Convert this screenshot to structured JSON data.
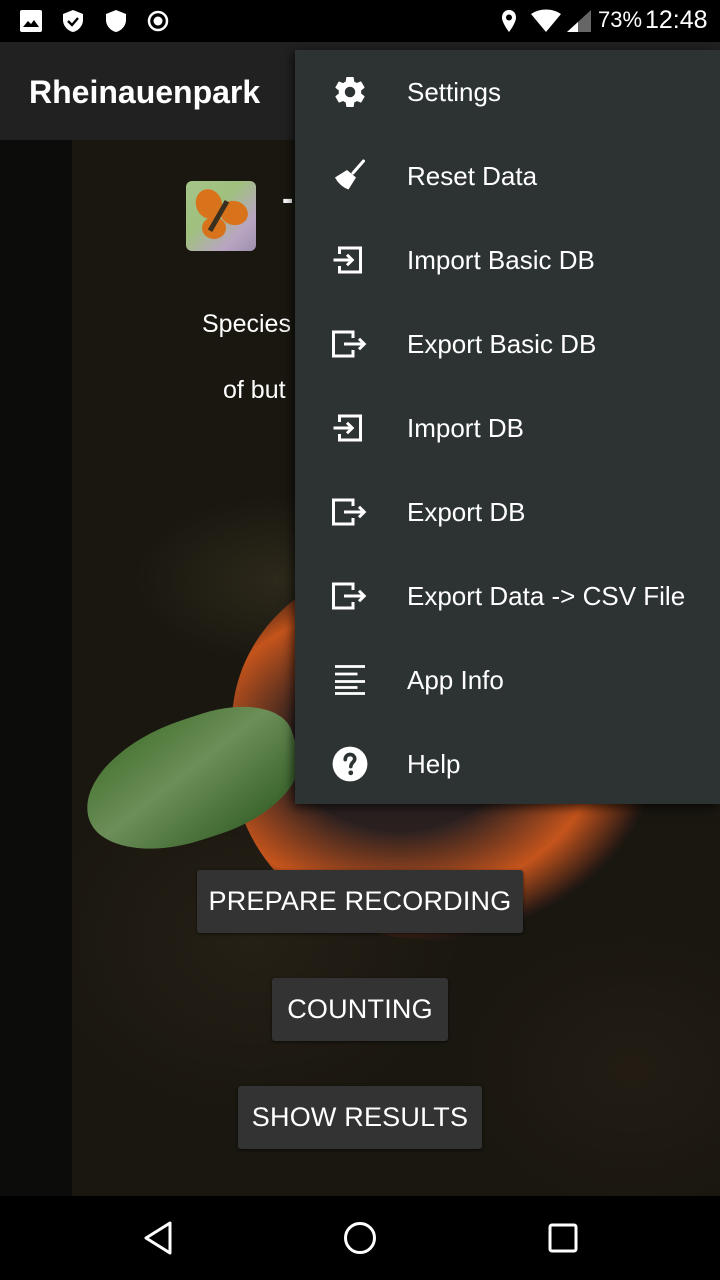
{
  "status_bar": {
    "left_icons": [
      "image-icon",
      "shield-check-icon",
      "shield-icon",
      "record-icon"
    ],
    "right_icons": [
      "location-icon",
      "wifi-icon",
      "cell-signal-icon"
    ],
    "battery": "73%",
    "time": "12:48"
  },
  "app_bar": {
    "title": "Rheinauenpark"
  },
  "main": {
    "heading_partial": "-",
    "subtext_line1_partial": "Species",
    "subtext_line2_partial": "of but",
    "buttons": {
      "prepare_recording": "PREPARE RECORDING",
      "counting": "COUNTING",
      "show_results": "SHOW RESULTS"
    }
  },
  "overflow_menu": {
    "items": [
      {
        "label": "Settings",
        "icon": "gear-icon"
      },
      {
        "label": "Reset Data",
        "icon": "broom-icon"
      },
      {
        "label": "Import Basic DB",
        "icon": "import-icon"
      },
      {
        "label": "Export Basic DB",
        "icon": "export-icon"
      },
      {
        "label": "Import DB",
        "icon": "import-icon"
      },
      {
        "label": "Export DB",
        "icon": "export-icon"
      },
      {
        "label": "Export Data -> CSV File",
        "icon": "export-icon"
      },
      {
        "label": "App Info",
        "icon": "text-lines-icon"
      },
      {
        "label": "Help",
        "icon": "help-circle-icon"
      }
    ]
  },
  "nav_bar": {
    "buttons": [
      "back",
      "home",
      "recents"
    ]
  }
}
